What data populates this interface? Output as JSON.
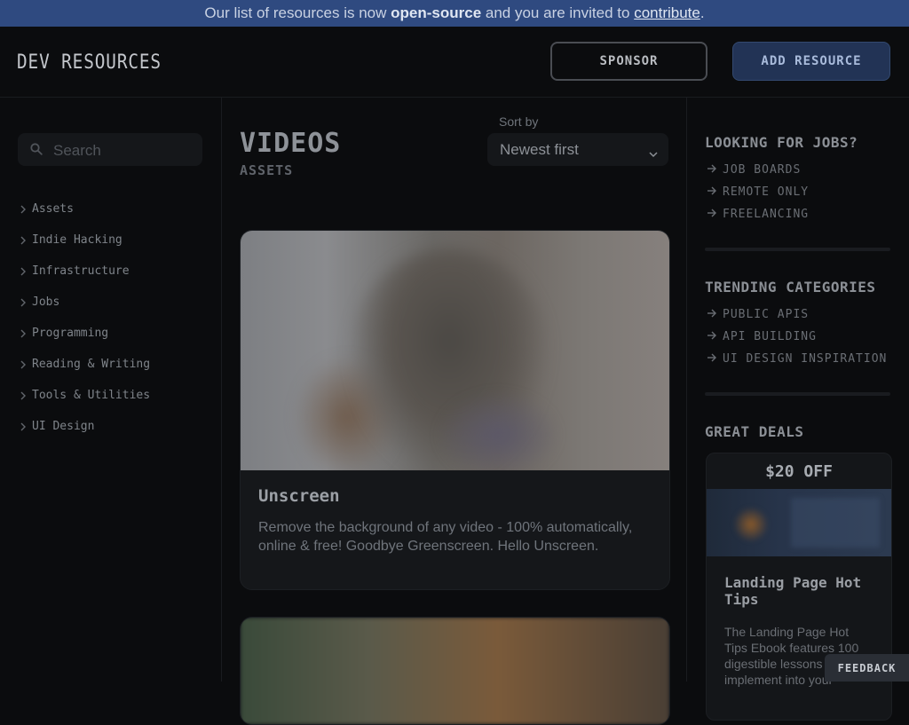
{
  "banner": {
    "text_1": "Our list of resources is now ",
    "bold": "open-source",
    "text_2": " and you are invited to ",
    "link": "contribute",
    "text_3": "."
  },
  "header": {
    "logo": "DEV RESOURCES",
    "sponsor_label": "SPONSOR",
    "add_label": "ADD RESOURCE"
  },
  "sidebar": {
    "search_placeholder": "Search",
    "items": [
      {
        "label": "Assets"
      },
      {
        "label": "Indie Hacking"
      },
      {
        "label": "Infrastructure"
      },
      {
        "label": "Jobs"
      },
      {
        "label": "Programming"
      },
      {
        "label": "Reading & Writing"
      },
      {
        "label": "Tools & Utilities"
      },
      {
        "label": "UI Design"
      }
    ]
  },
  "main": {
    "title": "VIDEOS",
    "subtitle": "ASSETS",
    "sort_label": "Sort by",
    "sort_value": "Newest first",
    "cards": [
      {
        "title": "Unscreen",
        "description": "Remove the background of any video - 100% automatically, online & free! Goodbye Greenscreen. Hello Unscreen."
      }
    ]
  },
  "right": {
    "jobs_title": "LOOKING FOR JOBS?",
    "jobs_links": [
      "JOB BOARDS",
      "REMOTE ONLY",
      "FREELANCING"
    ],
    "trending_title": "TRENDING CATEGORIES",
    "trending_links": [
      "PUBLIC APIS",
      "API BUILDING",
      "UI DESIGN INSPIRATION"
    ],
    "deals_title": "GREAT DEALS",
    "deal": {
      "badge": "$20 OFF",
      "title": "Landing Page Hot Tips",
      "description": "The Landing Page Hot Tips Ebook features 100 digestible lessons to implement into your"
    }
  },
  "feedback_label": "FEEDBACK",
  "icons": {
    "search": "search-icon",
    "chevron_right": "chevron-right-icon",
    "chevron_down": "chevron-down-icon",
    "arrow_right": "arrow-right-icon"
  },
  "colors": {
    "background": "#0b0c0e",
    "banner": "#2f4a80",
    "accent_button": "#223355"
  }
}
